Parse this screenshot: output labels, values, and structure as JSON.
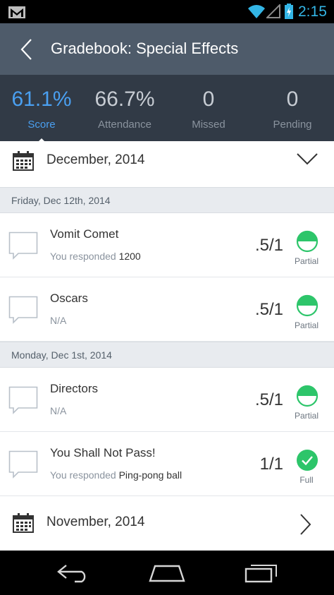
{
  "status_bar": {
    "time": "2:15"
  },
  "header": {
    "title": "Gradebook: Special Effects"
  },
  "stats": [
    {
      "value": "61.1%",
      "label": "Score"
    },
    {
      "value": "66.7%",
      "label": "Attendance"
    },
    {
      "value": "0",
      "label": "Missed"
    },
    {
      "value": "0",
      "label": "Pending"
    }
  ],
  "months": [
    {
      "label": "December, 2014"
    },
    {
      "label": "November, 2014"
    }
  ],
  "days": [
    {
      "label": "Friday, Dec 12th, 2014"
    },
    {
      "label": "Monday, Dec 1st, 2014"
    }
  ],
  "items": [
    {
      "name": "Vomit Comet",
      "response_prefix": "You responded ",
      "response_value": "1200",
      "score": ".5/1",
      "status": "Partial",
      "fraction": 0.5
    },
    {
      "name": "Oscars",
      "response_prefix": "N/A",
      "response_value": "",
      "score": ".5/1",
      "status": "Partial",
      "fraction": 0.5
    },
    {
      "name": "Directors",
      "response_prefix": "N/A",
      "response_value": "",
      "score": ".5/1",
      "status": "Partial",
      "fraction": 0.5
    },
    {
      "name": "You Shall Not Pass!",
      "response_prefix": "You responded ",
      "response_value": "Ping-pong ball",
      "score": "1/1",
      "status": "Full",
      "fraction": 1
    }
  ],
  "colors": {
    "accent": "#4a9ff0",
    "success": "#2dc56a",
    "appbar": "#4e5b6a",
    "statsbar": "#313a46"
  }
}
